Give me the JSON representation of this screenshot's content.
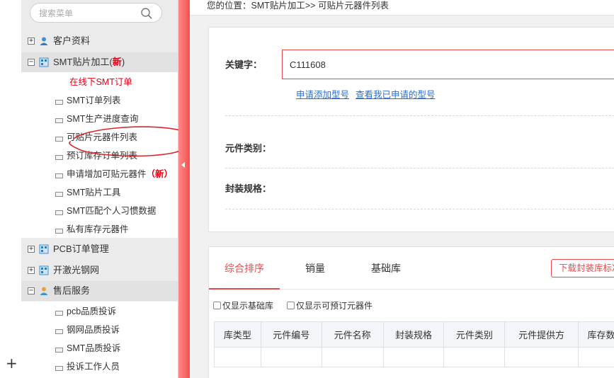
{
  "sidebar": {
    "search_placeholder": "搜索菜单",
    "groups": [
      {
        "label": "客户资料",
        "expanded": false
      },
      {
        "label": "SMT贴片加工",
        "label_paren_open": "(",
        "new_badge": "新",
        "label_paren_close": ")",
        "expanded": true
      },
      {
        "label": "PCB订单管理",
        "expanded": false
      },
      {
        "label": "开激光钢网",
        "expanded": false
      },
      {
        "label": "售后服务",
        "expanded": true
      }
    ],
    "smt_items": [
      {
        "label": "在线下SMT订单",
        "active": true
      },
      {
        "label": "SMT订单列表"
      },
      {
        "label": "SMT生产进度查询"
      },
      {
        "label": "可贴片元器件列表"
      },
      {
        "label": "预订库存订单列表"
      },
      {
        "label": "申请增加可贴元器件",
        "new_badge": "（新）"
      },
      {
        "label": "SMT贴片工具"
      },
      {
        "label": "SMT匹配个人习惯数据"
      },
      {
        "label": "私有库存元器件"
      }
    ],
    "service_items": [
      {
        "label": "pcb品质投诉"
      },
      {
        "label": "钢网品质投诉"
      },
      {
        "label": "SMT品质投诉"
      },
      {
        "label": "投诉工作人员"
      }
    ]
  },
  "breadcrumb": "您的位置：SMT贴片加工>> 可贴片元器件列表",
  "filter": {
    "keyword_label": "关键字：",
    "keyword_value": "C111608",
    "link_apply": "申请添加型号",
    "link_view": "查看我已申请的型号",
    "category_label": "元件类别：",
    "package_label": "封装规格："
  },
  "results": {
    "tabs": [
      "综合排序",
      "销量",
      "基础库"
    ],
    "active_tab": 0,
    "download_button": "下载封装库标准",
    "checkboxes": [
      {
        "label": "仅显示基础库",
        "checked": false
      },
      {
        "label": "仅显示可预订元器件",
        "checked": false
      }
    ],
    "columns": [
      "库类型",
      "元件编号",
      "元件名称",
      "封装规格",
      "元件类别",
      "元件提供方",
      "库存数"
    ]
  },
  "colors": {
    "accent": "#e64b4b",
    "link": "#2b6fcf",
    "new_badge": "#e60012"
  }
}
